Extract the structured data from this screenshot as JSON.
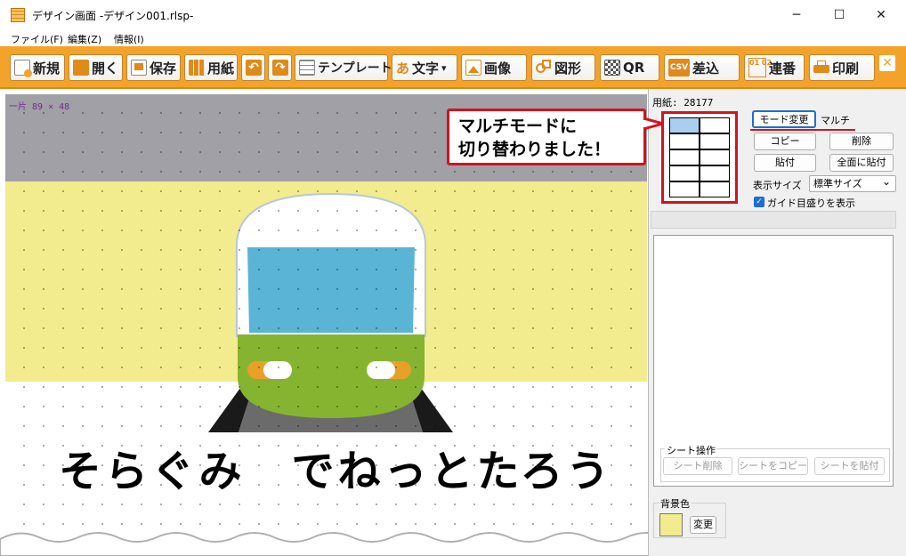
{
  "window": {
    "title": "デザイン画面 -デザイン001.rlsp-",
    "minimize": "─",
    "maximize": "☐",
    "close": "✕"
  },
  "menu": [
    {
      "label": "ファイル(F)"
    },
    {
      "label": "編集(Z)"
    },
    {
      "label": "情報(I)"
    }
  ],
  "toolbar": {
    "new": "新規",
    "open": "開く",
    "save": "保存",
    "paper": "用紙",
    "template": "テンプレート",
    "text_icon": "あ",
    "text": "文字",
    "text_arrow": "▾",
    "image": "画像",
    "shape": "図形",
    "qr": "QR",
    "csv_icon": "CSV",
    "merge": "差込",
    "serial_icon": "01 02",
    "serial": "連番",
    "print": "印刷",
    "close_panel": "✕"
  },
  "canvas": {
    "coordinates": "一片 89   × 48",
    "caption": "そらぐみ　でねっとたろう",
    "colors": {
      "yellow": "#f2ec8e",
      "gray": "#a1a0a6",
      "train_green": "#86b430",
      "train_window": "#5ab4d6"
    }
  },
  "callout": {
    "line1": "マルチモードに",
    "line2": "切り替わりました！"
  },
  "panel": {
    "paper_label": "用紙: 28177",
    "mode_change": "モード変更",
    "mode_value": "マルチ",
    "copy": "コピー",
    "delete": "削除",
    "paste": "貼付",
    "paste_all": "全面に貼付",
    "display_size_label": "表示サイズ",
    "display_size_value": "標準サイズ",
    "display_size_arrow": "⌄",
    "guide_label": "ガイド目盛りを表示",
    "guide_checked": "✓",
    "sheet_ops": {
      "title": "シート操作",
      "delete": "シート削除",
      "copy": "シートをコピー",
      "paste": "シートを貼付"
    },
    "background": {
      "title": "背景色",
      "change": "変更",
      "color": "#f2ec8e"
    },
    "layout_grid": {
      "rows": 5,
      "cols": 2,
      "selected_row": 1,
      "selected_col": 1
    }
  }
}
